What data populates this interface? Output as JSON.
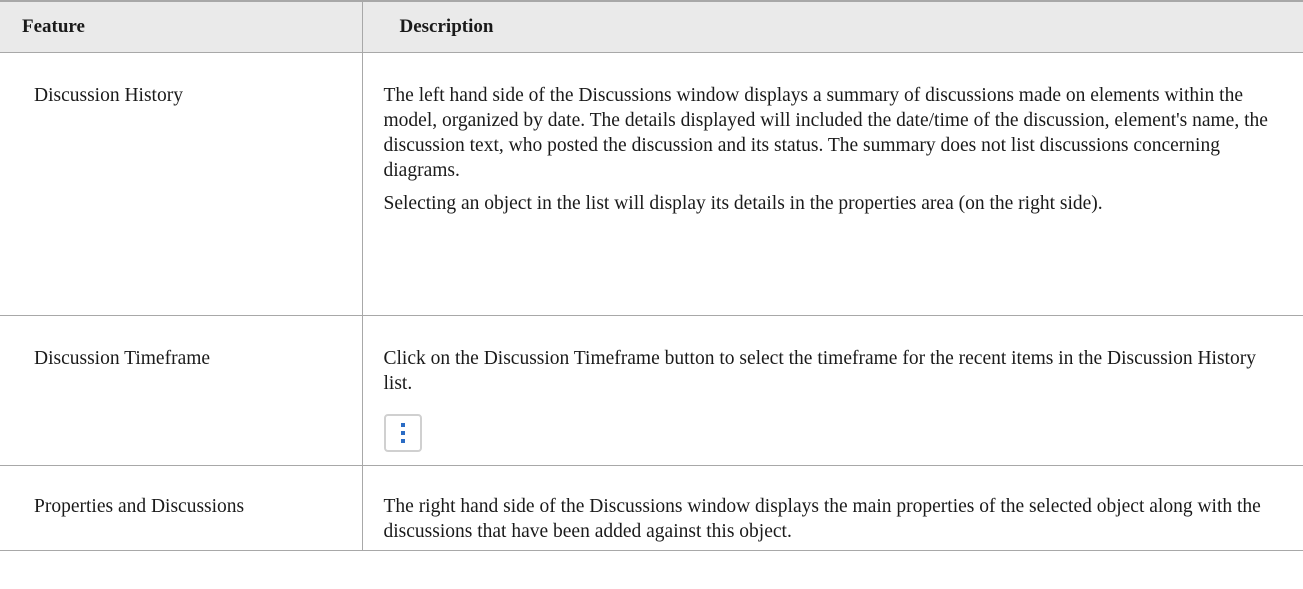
{
  "table": {
    "headers": {
      "feature": "Feature",
      "description": "Description"
    },
    "rows": [
      {
        "feature": "Discussion History",
        "paragraphs": [
          "The left hand side of the Discussions window displays a summary of discussions made on elements within the model, organized by date. The details displayed will included the date/time of the discussion, element's name, the discussion text, who posted the discussion and its status. The summary does not list discussions concerning diagrams.",
          "Selecting an object in the list will display its details in the properties area (on the right side)."
        ]
      },
      {
        "feature": "Discussion Timeframe",
        "paragraphs": [
          "Click on the Discussion Timeframe button to select the timeframe for the recent items in the Discussion History list."
        ],
        "button_icon": "vertical-ellipsis-icon"
      },
      {
        "feature": "Properties and Discussions",
        "paragraphs": [
          "The right hand side of the Discussions window displays the main properties of the selected object along with the discussions that have been added against this object."
        ]
      }
    ]
  },
  "colors": {
    "header_bg": "#eaeaea",
    "border": "#a8a8a8",
    "icon_blue": "#2b6cc4"
  }
}
